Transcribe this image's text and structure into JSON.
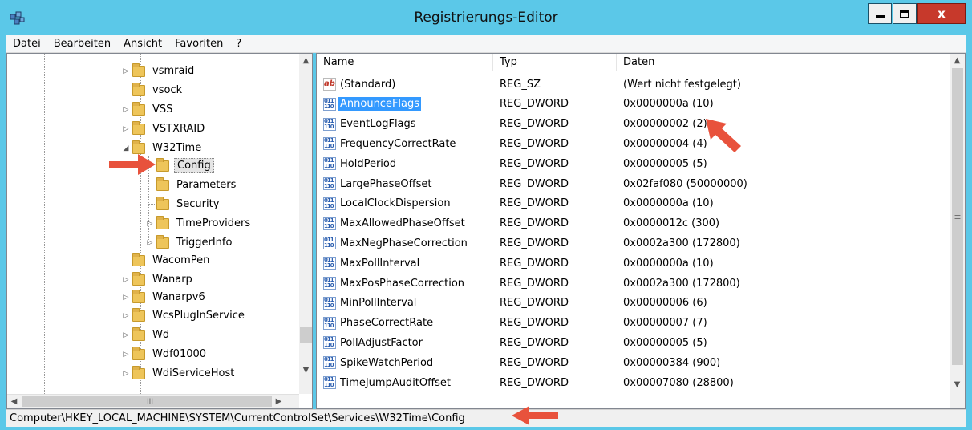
{
  "window": {
    "title": "Registrierungs-Editor",
    "controls": {
      "minimize": "_",
      "maximize": "□",
      "close": "x"
    }
  },
  "menu": [
    "Datei",
    "Bearbeiten",
    "Ansicht",
    "Favoriten",
    "?"
  ],
  "tree": {
    "items": [
      {
        "label": "vsmraid",
        "expander": "▷"
      },
      {
        "label": "vsock",
        "expander": ""
      },
      {
        "label": "VSS",
        "expander": "▷"
      },
      {
        "label": "VSTXRAID",
        "expander": "▷"
      },
      {
        "label": "W32Time",
        "expander": "◢"
      },
      {
        "label": "Config",
        "expander": "",
        "selected": true
      },
      {
        "label": "Parameters",
        "expander": ""
      },
      {
        "label": "Security",
        "expander": ""
      },
      {
        "label": "TimeProviders",
        "expander": "▷"
      },
      {
        "label": "TriggerInfo",
        "expander": "▷"
      },
      {
        "label": "WacomPen",
        "expander": ""
      },
      {
        "label": "Wanarp",
        "expander": "▷"
      },
      {
        "label": "Wanarpv6",
        "expander": "▷"
      },
      {
        "label": "WcsPlugInService",
        "expander": "▷"
      },
      {
        "label": "Wd",
        "expander": "▷"
      },
      {
        "label": "Wdf01000",
        "expander": "▷"
      },
      {
        "label": "WdiServiceHost",
        "expander": "▷"
      }
    ],
    "scroll_glyph": "III"
  },
  "list": {
    "columns": [
      "Name",
      "Typ",
      "Daten"
    ],
    "rows": [
      {
        "icon": "sz",
        "name": "(Standard)",
        "type": "REG_SZ",
        "data": "(Wert nicht festgelegt)"
      },
      {
        "icon": "dw",
        "name": "AnnounceFlags",
        "type": "REG_DWORD",
        "data": "0x0000000a (10)",
        "selected": true
      },
      {
        "icon": "dw",
        "name": "EventLogFlags",
        "type": "REG_DWORD",
        "data": "0x00000002 (2)"
      },
      {
        "icon": "dw",
        "name": "FrequencyCorrectRate",
        "type": "REG_DWORD",
        "data": "0x00000004 (4)"
      },
      {
        "icon": "dw",
        "name": "HoldPeriod",
        "type": "REG_DWORD",
        "data": "0x00000005 (5)"
      },
      {
        "icon": "dw",
        "name": "LargePhaseOffset",
        "type": "REG_DWORD",
        "data": "0x02faf080 (50000000)"
      },
      {
        "icon": "dw",
        "name": "LocalClockDispersion",
        "type": "REG_DWORD",
        "data": "0x0000000a (10)"
      },
      {
        "icon": "dw",
        "name": "MaxAllowedPhaseOffset",
        "type": "REG_DWORD",
        "data": "0x0000012c (300)"
      },
      {
        "icon": "dw",
        "name": "MaxNegPhaseCorrection",
        "type": "REG_DWORD",
        "data": "0x0002a300 (172800)"
      },
      {
        "icon": "dw",
        "name": "MaxPollInterval",
        "type": "REG_DWORD",
        "data": "0x0000000a (10)"
      },
      {
        "icon": "dw",
        "name": "MaxPosPhaseCorrection",
        "type": "REG_DWORD",
        "data": "0x0002a300 (172800)"
      },
      {
        "icon": "dw",
        "name": "MinPollInterval",
        "type": "REG_DWORD",
        "data": "0x00000006 (6)"
      },
      {
        "icon": "dw",
        "name": "PhaseCorrectRate",
        "type": "REG_DWORD",
        "data": "0x00000007 (7)"
      },
      {
        "icon": "dw",
        "name": "PollAdjustFactor",
        "type": "REG_DWORD",
        "data": "0x00000005 (5)"
      },
      {
        "icon": "dw",
        "name": "SpikeWatchPeriod",
        "type": "REG_DWORD",
        "data": "0x00000384 (900)"
      },
      {
        "icon": "dw",
        "name": "TimeJumpAuditOffset",
        "type": "REG_DWORD",
        "data": "0x00007080 (28800)"
      }
    ],
    "scroll_glyph": "≡"
  },
  "status": {
    "path": "Computer\\HKEY_LOCAL_MACHINE\\SYSTEM\\CurrentControlSet\\Services\\W32Time\\Config"
  },
  "icons": {
    "app": "registry-editor-icon",
    "string_value": "ab",
    "dword_value": "011 110"
  },
  "colors": {
    "titlebar": "#5bc8e8",
    "close": "#c7392b",
    "selection": "#3399ff",
    "annotation_arrow": "#e8523c"
  }
}
